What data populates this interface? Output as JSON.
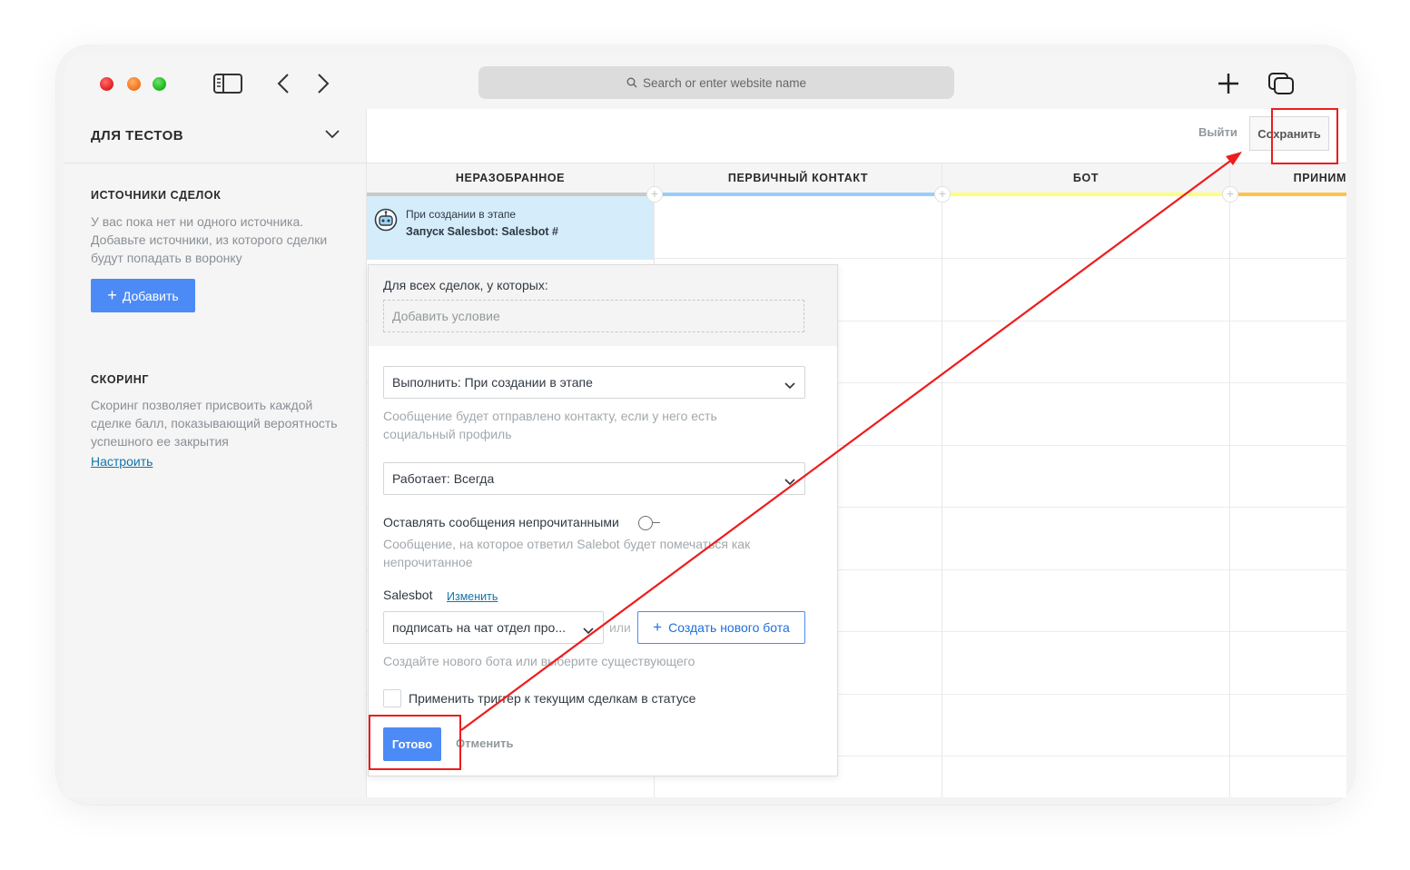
{
  "browser": {
    "address_placeholder": "Search or enter website name",
    "icons": [
      "sidebar-toggle-icon",
      "back-icon",
      "forward-icon",
      "search-icon",
      "plus-icon",
      "tabs-overview-icon"
    ]
  },
  "pipeline": {
    "name": "ДЛЯ ТЕСТОВ"
  },
  "sidebar": {
    "sources": {
      "title": "ИСТОЧНИКИ СДЕЛОК",
      "text": "У вас пока нет ни одного источника. Добавьте источники, из которого сделки будут попадать в воронку",
      "add_label": "Добавить"
    },
    "scoring": {
      "title": "СКОРИНГ",
      "text": "Скоринг позволяет присвоить каждой сделке балл, показывающий вероятность успешного ее закрытия",
      "link": "Настроить"
    }
  },
  "topbar": {
    "exit_label": "Выйти",
    "save_label": "Сохранить"
  },
  "columns": [
    {
      "title": "НЕРАЗОБРАННОЕ",
      "color": "#c9c9c9"
    },
    {
      "title": "ПЕРВИЧНЫЙ КОНТАКТ",
      "color": "#99ccff"
    },
    {
      "title": "БОТ",
      "color": "#fffd7f"
    },
    {
      "title": "ПРИНИМ",
      "color": "#ffc34d"
    }
  ],
  "trigger": {
    "line1": "При создании в этапе",
    "line2": "Запуск Salesbot: Salesbot #"
  },
  "popup": {
    "condition_label": "Для всех сделок, у которых:",
    "condition_placeholder": "Добавить условие",
    "execute_select": "Выполнить: При создании в этапе",
    "execute_hint": "Сообщение будет отправлено контакту, если у него есть социальный профиль",
    "works_select": "Работает: Всегда",
    "unread_label": "Оставлять сообщения непрочитанными",
    "unread_hint": "Сообщение, на которое ответил Salebot будет помечаться как непрочитанное",
    "salesbot_label": "Salesbot",
    "change_link": "Изменить",
    "bot_select": "подписать на чат отдел про...",
    "or_text": "или",
    "create_bot_label": "Создать нового бота",
    "create_hint": "Создайте нового бота или выберите существующего",
    "apply_label": "Применить триггер к текущим сделкам в статусе",
    "done_label": "Готово",
    "cancel_label": "Отменить"
  },
  "annotation": {
    "color": "#ee1c1c"
  }
}
